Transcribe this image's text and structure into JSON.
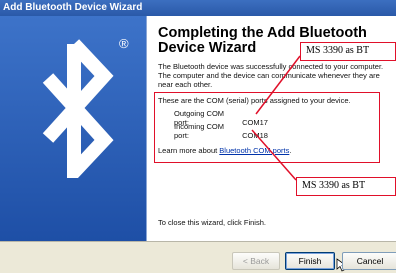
{
  "window": {
    "title": "Add Bluetooth Device Wizard"
  },
  "sidebar": {
    "logo_icon": "bluetooth-icon",
    "registered_mark": "®"
  },
  "main": {
    "heading_line1": "Completing the Add Bluetooth",
    "heading_line2": "Device Wizard",
    "intro": "The Bluetooth device was successfully connected to your computer. The computer and the device can communicate whenever they are near each other.",
    "com_intro": "These are the COM (serial) ports assigned to your device.",
    "ports": [
      {
        "label": "Outgoing COM port:",
        "value": "COM17"
      },
      {
        "label": "Incoming COM port:",
        "value": "COM18"
      }
    ],
    "learn_prefix": "Learn more about ",
    "learn_link": "Bluetooth COM ports",
    "learn_suffix": ".",
    "finish_note": "To close this wizard, click Finish."
  },
  "annotations": {
    "callout_top": "MS 3390 as BT",
    "callout_bottom": "MS 3390 as BT",
    "color": "#e0102a"
  },
  "buttons": {
    "back": "< Back",
    "finish": "Finish",
    "cancel": "Cancel"
  },
  "colors": {
    "title_bar": "#2a59a8",
    "sidebar": "#3d73c9",
    "footer": "#ece9d8",
    "link": "#0033aa"
  }
}
